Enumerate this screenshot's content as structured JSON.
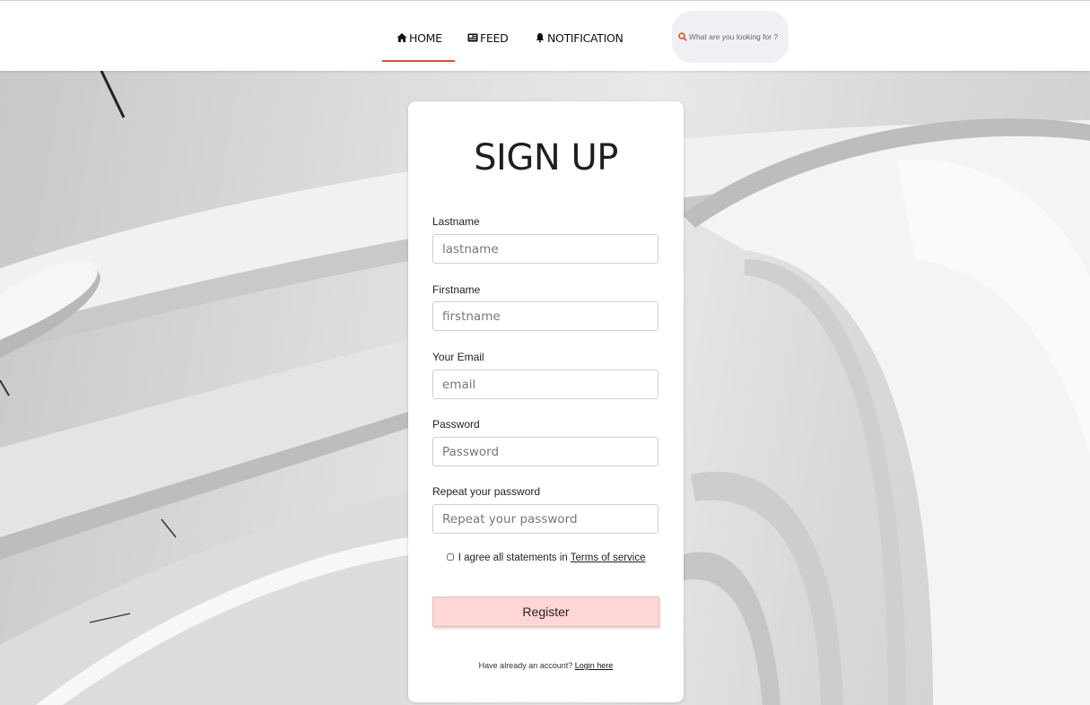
{
  "nav": {
    "items": [
      {
        "label": "HOME",
        "icon": "home-icon"
      },
      {
        "label": "FEED",
        "icon": "feed-icon"
      },
      {
        "label": "NOTIFICATION",
        "icon": "bell-icon"
      }
    ],
    "active_index": 0,
    "search_placeholder": "What are you looking for ?"
  },
  "colors": {
    "accent": "#e2502c",
    "register_bg": "#ffd6d6",
    "search_bg": "#eef0f4"
  },
  "signup": {
    "title": "SIGN UP",
    "fields": [
      {
        "label": "Lastname",
        "placeholder": "lastname"
      },
      {
        "label": "Firstname",
        "placeholder": "firstname"
      },
      {
        "label": "Your Email",
        "placeholder": "email"
      },
      {
        "label": "Password",
        "placeholder": "Password"
      },
      {
        "label": "Repeat your password",
        "placeholder": "Repeat your password"
      }
    ],
    "agree_text": "I agree all statements in",
    "terms_link": "Terms of service",
    "register_label": "Register",
    "login_prompt": "Have already an account?",
    "login_link": "Login here"
  }
}
